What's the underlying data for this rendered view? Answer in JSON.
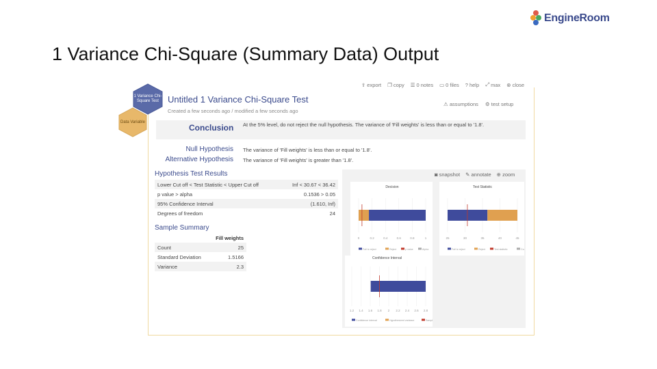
{
  "slide": {
    "title": "1 Variance Chi-Square (Summary Data) Output"
  },
  "logo": {
    "text": "EngineRoom",
    "mark": "®"
  },
  "toolbar": {
    "items": [
      {
        "label": "export",
        "icon": "export-icon"
      },
      {
        "label": "copy",
        "icon": "copy-icon"
      },
      {
        "label": "0 notes",
        "icon": "notes-icon"
      },
      {
        "label": "0 files",
        "icon": "folder-icon"
      },
      {
        "label": "help",
        "icon": "help-icon"
      },
      {
        "label": "max",
        "icon": "maximize-icon"
      },
      {
        "label": "close",
        "icon": "close-icon"
      }
    ]
  },
  "hex": {
    "primary": "1 Variance Chi-Square Test",
    "secondary": "Data Variable",
    "primary_color": "#5a6aa8",
    "secondary_color": "#e8b86a"
  },
  "test": {
    "title": "Untitled 1 Variance Chi-Square Test",
    "subtitle": "Created a few seconds ago / modified a few seconds ago",
    "assumptions": "assumptions",
    "setup": "test setup"
  },
  "conclusion": {
    "label": "Conclusion",
    "text": "At the 5% level, do not reject the null hypothesis. The variance of 'Fill weights' is less than or equal to '1.8'."
  },
  "hypotheses": {
    "null_label": "Null Hypothesis",
    "null_text": "The variance of 'Fill weights' is less than or equal to '1.8'.",
    "alt_label": "Alternative Hypothesis",
    "alt_text": "The variance of 'Fill weights' is greater than '1.8'."
  },
  "results": {
    "title": "Hypothesis Test Results",
    "rows": [
      {
        "label": "Lower Cut off < Test Statistic < Upper Cut off",
        "value": "Inf < 30.67 < 36.42"
      },
      {
        "label": "p value > alpha",
        "value": "0.1536 > 0.05"
      },
      {
        "label": "95% Confidence Interval",
        "value": "(1.610, Inf)"
      },
      {
        "label": "Degrees of freedom",
        "value": "24"
      }
    ]
  },
  "summary": {
    "title": "Sample Summary",
    "column": "Fill weights",
    "rows": [
      {
        "label": "Count",
        "value": "25"
      },
      {
        "label": "Standard Deviation",
        "value": "1.5166"
      },
      {
        "label": "Variance",
        "value": "2.3"
      }
    ]
  },
  "chart_actions": {
    "snapshot": "snapshot",
    "annotate": "annotate",
    "zoom": "zoom"
  },
  "colors": {
    "bar_blue": "#3f4b9c",
    "bar_orange": "#e0a050",
    "marker_red": "#c0392b",
    "accent": "#3a4a8c"
  },
  "chart_data": [
    {
      "type": "bar",
      "title": "Decision",
      "orientation": "horizontal",
      "segments": [
        {
          "series": "p value",
          "value": 0.1536,
          "color": "#e0a050"
        },
        {
          "series": "Fail to reject",
          "value": 0.8464,
          "color": "#3f4b9c"
        }
      ],
      "markers": [
        {
          "name": "alpha",
          "value": 0.05
        }
      ],
      "xlim": [
        0,
        1
      ],
      "x_ticks": [
        "0",
        "0.2",
        "0.4",
        "0.6",
        "0.8",
        "1"
      ],
      "legend": [
        "Fail to reject",
        "Reject",
        "p value",
        "Alpha"
      ]
    },
    {
      "type": "bar",
      "title": "Test Statistic",
      "orientation": "horizontal",
      "segments": [
        {
          "series": "Fail to reject region",
          "start": 25,
          "end": 36.42,
          "color": "#3f4b9c"
        },
        {
          "series": "Reject region",
          "start": 36.42,
          "end": 45,
          "color": "#e0a050"
        }
      ],
      "markers": [
        {
          "name": "Test statistic",
          "value": 30.67
        }
      ],
      "xlim": [
        25,
        45
      ],
      "x_ticks": [
        "25",
        "30",
        "35",
        "40",
        "45"
      ],
      "legend": [
        "Fail to reject",
        "Reject",
        "Test statistic",
        "Cut off"
      ]
    },
    {
      "type": "bar",
      "title": "Confidence Interval",
      "orientation": "horizontal",
      "segments": [
        {
          "series": "Confidence interval",
          "start": 1.61,
          "end": 2.8,
          "color": "#3f4b9c"
        }
      ],
      "markers": [
        {
          "name": "Hypothesized variance",
          "value": 1.8
        }
      ],
      "xlim": [
        1.2,
        2.8
      ],
      "x_ticks": [
        "1.2",
        "1.4",
        "1.6",
        "1.8",
        "2",
        "2.2",
        "2.4",
        "2.6",
        "2.8"
      ],
      "legend": [
        "Confidence interval",
        "Hypothesized variance",
        "Sample variance"
      ]
    }
  ]
}
